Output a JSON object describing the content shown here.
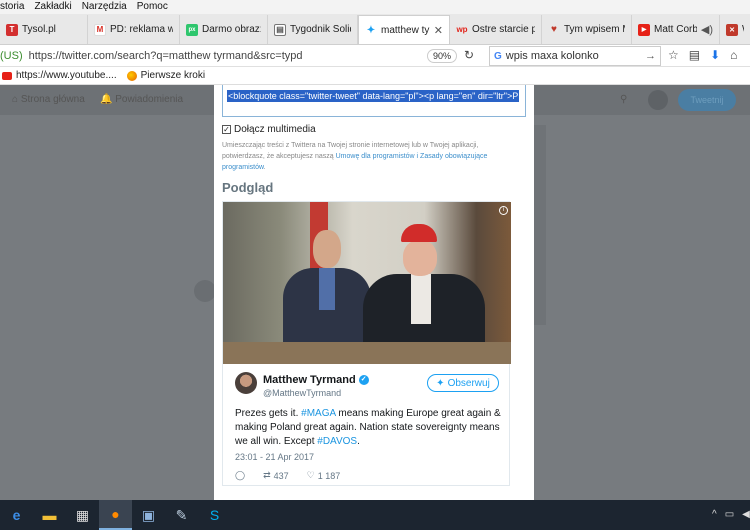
{
  "menu": [
    "storia",
    "Zakładki",
    "Narzędzia",
    "Pomoc"
  ],
  "tabs": [
    {
      "label": "Tysol.pl",
      "icon": "tysol-icon",
      "color": "#d32f2f",
      "glyph": "T"
    },
    {
      "label": "PD: reklama w ar",
      "icon": "gmail-icon",
      "color": "#d93025",
      "glyph": "M"
    },
    {
      "label": "Darmo obraz: Ka",
      "icon": "pixabay-icon",
      "color": "#2ec66d",
      "glyph": "px"
    },
    {
      "label": "Tygodnik Solidar",
      "icon": "tygodnik-icon",
      "color": "#555555",
      "glyph": "▤"
    },
    {
      "label": "matthew tyrm",
      "icon": "twitter-icon",
      "color": "#1da1f2",
      "glyph": "🐦",
      "active": true
    },
    {
      "label": "Ostre starcie poli",
      "icon": "wp-icon",
      "color": "#e2231a",
      "glyph": "wp"
    },
    {
      "label": "Tym wpisem Ma",
      "icon": "pin-icon",
      "color": "#c0392b",
      "glyph": "♥"
    },
    {
      "label": "Matt Corby -",
      "icon": "youtube-icon",
      "color": "#e62117",
      "glyph": "▶"
    },
    {
      "label": "W",
      "icon": "close-box-icon",
      "color": "#c0392b",
      "glyph": "✕"
    }
  ],
  "nav": {
    "secure": "(US)",
    "url": "https://twitter.com/search?q=matthew tyrmand&src=typd",
    "zoom": "90%",
    "search": "wpis maxa kolonko"
  },
  "bookmarks": [
    "https://www.youtube....",
    "Pierwsze kroki"
  ],
  "twitter_nav": {
    "home": "Strona główna",
    "notifications": "Powiadomienia",
    "tweet_button": "Tweetnij"
  },
  "modal": {
    "code": "<blockquote class=\"twitter-tweet\" data-lang=\"pl\"><p lang=\"en\" dir=\"ltr\">P",
    "include_media": "Dołącz multimedia",
    "legal_1": "Umieszczając treści z Twittera na Twojej stronie internetowej lub w Twojej aplikacji, potwierdzasz, że akceptujesz naszą",
    "legal_link": "Umowę dla programistów i Zasady obowiązujące programistów",
    "legal_end": ".",
    "preview": "Podgląd"
  },
  "tweet": {
    "name": "Matthew Tyrmand",
    "handle": "@MatthewTyrmand",
    "follow": "Obserwuj",
    "text_1": "Prezes gets it. ",
    "tag_1": "#MAGA",
    "text_2": " means making Europe great again & making Poland great again. Nation state sovereignty means we all win. Except ",
    "tag_2": "#DAVOS",
    "text_3": ".",
    "time": "23:01 - 21 Apr 2017",
    "retweets": "437",
    "likes": "1 187"
  },
  "colors": {
    "twitter_blue": "#1da1f2",
    "overlay": "#777b7f",
    "selection": "#2a63c7"
  }
}
